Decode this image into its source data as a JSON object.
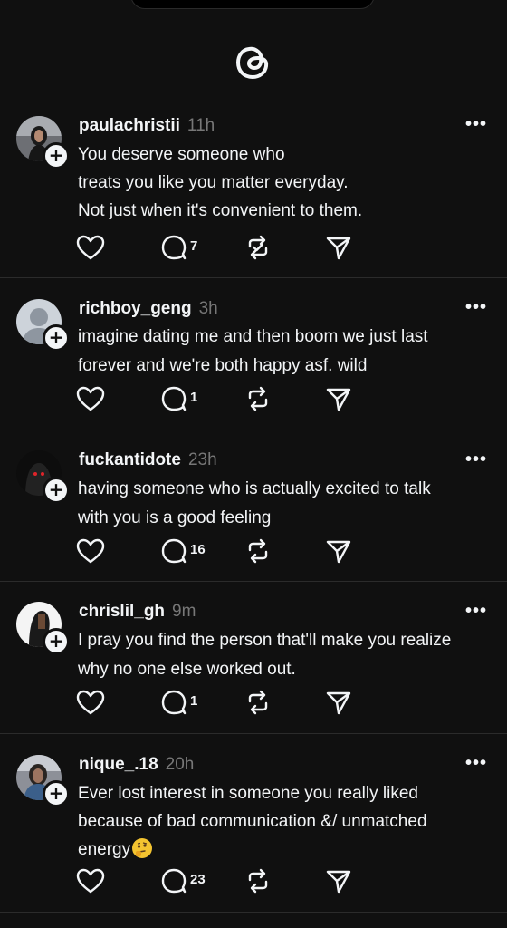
{
  "app": {
    "logo_icon": "threads-logo-icon"
  },
  "posts": [
    {
      "username": "paulachristii",
      "time": "11h",
      "lines": [
        "You deserve someone who",
        "treats you like you matter everyday.",
        "Not just when it's convenient to them."
      ],
      "replies": "7",
      "reposted": true
    },
    {
      "username": "richboy_geng",
      "time": "3h",
      "lines": [
        "imagine dating me and then boom we just last",
        "forever and we're both happy asf. wild"
      ],
      "replies": "1",
      "reposted": false
    },
    {
      "username": "fuckantidote",
      "time": "23h",
      "lines": [
        "having someone who is actually excited to talk",
        "with you is a good feeling"
      ],
      "replies": "16",
      "reposted": false
    },
    {
      "username": "chrislil_gh",
      "time": "9m",
      "lines": [
        "I pray you find the person that'll make you realize",
        "why no one else worked out."
      ],
      "replies": "1",
      "reposted": false
    },
    {
      "username": "nique_.18",
      "time": "20h",
      "lines": [
        "Ever lost interest in someone you really liked",
        "because of bad communication &/ unmatched",
        "energy"
      ],
      "emoji": "thinking-face-emoji",
      "replies": "23",
      "reposted": false
    }
  ],
  "icons": {
    "like": "heart-icon",
    "reply": "comment-icon",
    "repost": "repost-icon",
    "share": "send-icon",
    "more": "more-options-icon",
    "follow": "plus-follow-icon"
  },
  "more_glyph": "•••",
  "plus_glyph": "+"
}
